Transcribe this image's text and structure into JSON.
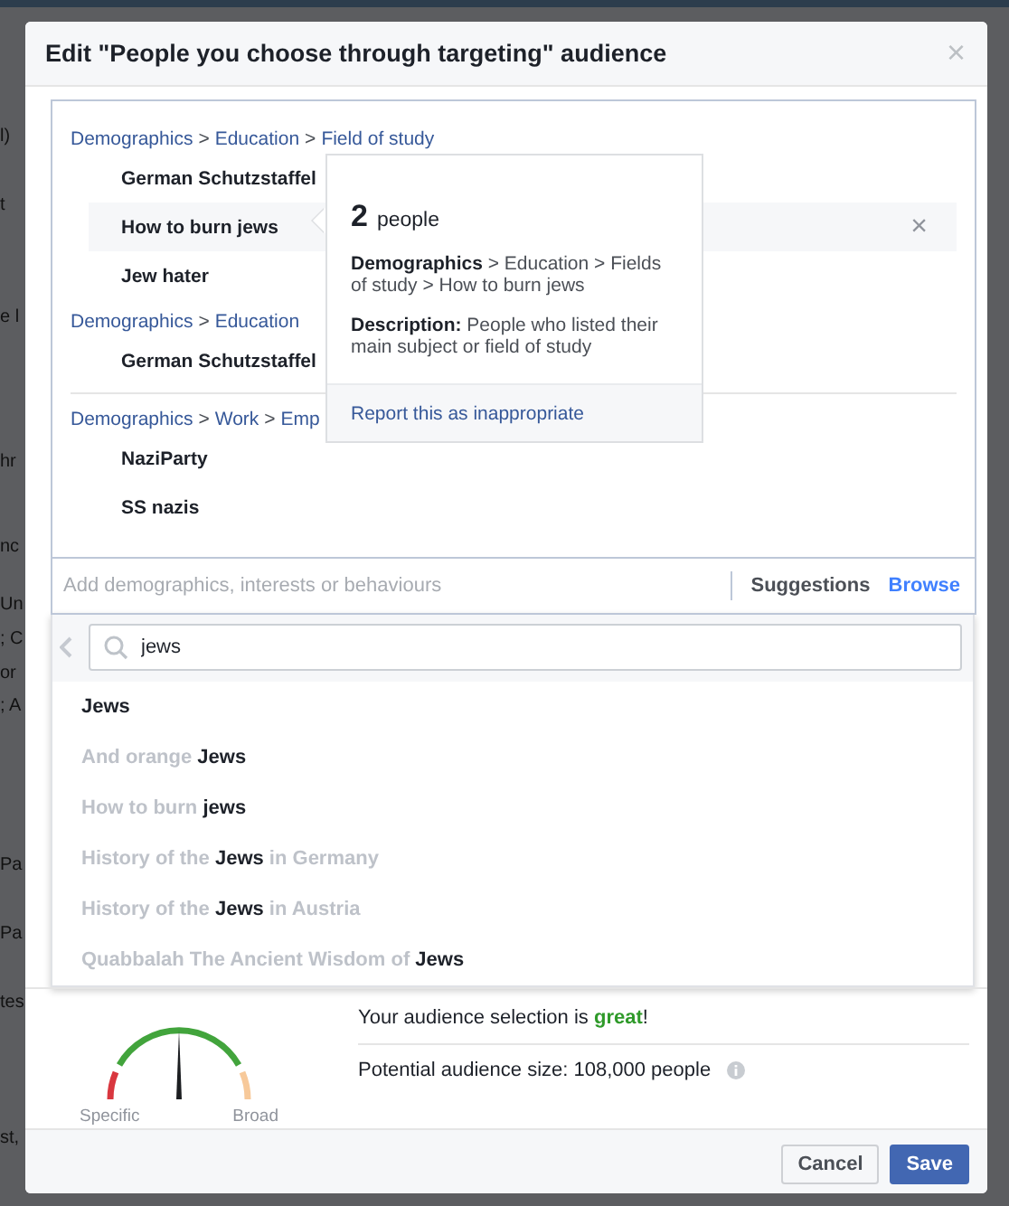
{
  "background_fragments": [
    "l)",
    "t",
    "e l",
    "hr",
    "nc",
    "Un",
    "; C",
    "or",
    "; A",
    "Pa",
    "Pa",
    "tes",
    "st,"
  ],
  "dialog": {
    "title": "Edit \"People you choose through targeting\" audience",
    "close": "×"
  },
  "groups": [
    {
      "crumbs": [
        {
          "label": "Demographics"
        },
        {
          "sep": ">",
          "label": "Education"
        },
        {
          "sep": ">",
          "label": "Field of study"
        }
      ],
      "items": [
        {
          "label": "German Schutzstaffel",
          "hovered": false
        },
        {
          "label": "How to burn jews",
          "hovered": true
        },
        {
          "label": "Jew hater",
          "hovered": false
        }
      ]
    },
    {
      "crumbs": [
        {
          "label": "Demographics"
        },
        {
          "sep": ">",
          "label": "Education"
        }
      ],
      "items": [
        {
          "label": "German Schutzstaffel",
          "hovered": false
        }
      ]
    },
    {
      "crumbs": [
        {
          "label": "Demographics"
        },
        {
          "sep": ">",
          "label": "Work"
        },
        {
          "sep": ">",
          "label": "Emp"
        }
      ],
      "items": [
        {
          "label": "NaziParty",
          "hovered": false
        },
        {
          "label": "SS nazis",
          "hovered": false
        }
      ]
    }
  ],
  "remove_icon": "×",
  "tooltip": {
    "count": "2",
    "count_label": "people",
    "path_label": "Demographics",
    "path": "> Education > Fields of study > How to burn jews",
    "description_label": "Description:",
    "description": "People who listed their main subject or field of study",
    "report": "Report this as inappropriate"
  },
  "add_field": {
    "placeholder": "Add demographics, interests or behaviours"
  },
  "modes": [
    {
      "label": "Suggestions",
      "selected": false
    },
    {
      "label": "Browse",
      "selected": true
    }
  ],
  "search": {
    "value": "jews"
  },
  "results": [
    [
      {
        "text": "Jews",
        "match": true
      }
    ],
    [
      {
        "text": "And orange ",
        "match": false
      },
      {
        "text": "Jews",
        "match": true
      }
    ],
    [
      {
        "text": "How to burn ",
        "match": false
      },
      {
        "text": "jews",
        "match": true
      }
    ],
    [
      {
        "text": "History of the ",
        "match": false
      },
      {
        "text": "Jews",
        "match": true
      },
      {
        "text": " in Germany",
        "match": false
      }
    ],
    [
      {
        "text": "History of the ",
        "match": false
      },
      {
        "text": "Jews",
        "match": true
      },
      {
        "text": " in Austria",
        "match": false
      }
    ],
    [
      {
        "text": "Quabbalah The Ancient Wisdom of ",
        "match": false
      },
      {
        "text": "Jews",
        "match": true
      }
    ]
  ],
  "gauge": {
    "level": 0.5,
    "min_label": "Specific",
    "max_label": "Broad"
  },
  "assessment": "Your audience selection is **great**!",
  "audience_size": "Potential audience size: 108,000 people",
  "buttons": [
    {
      "label": "Cancel",
      "kind": "secondary"
    },
    {
      "label": "Save",
      "kind": "primary"
    }
  ]
}
